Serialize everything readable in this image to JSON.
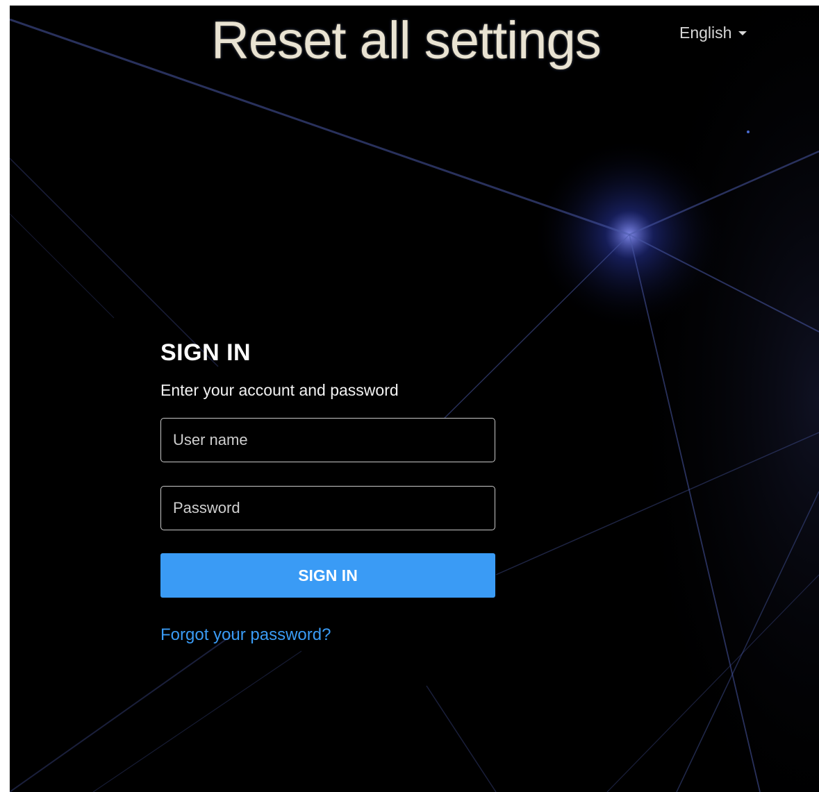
{
  "banner": {
    "title": "Reset all settings"
  },
  "language": {
    "selected": "English"
  },
  "form": {
    "title": "SIGN IN",
    "subtitle": "Enter your account and password",
    "username_placeholder": "User name",
    "password_placeholder": "Password",
    "submit_label": "SIGN IN",
    "forgot_link": "Forgot your password?"
  },
  "colors": {
    "background": "#000000",
    "accent": "#3a9bf5",
    "input_border": "#c9c9c9",
    "glow": "#5a6cff"
  },
  "icons": {
    "language_dropdown": "caret-down-icon"
  }
}
